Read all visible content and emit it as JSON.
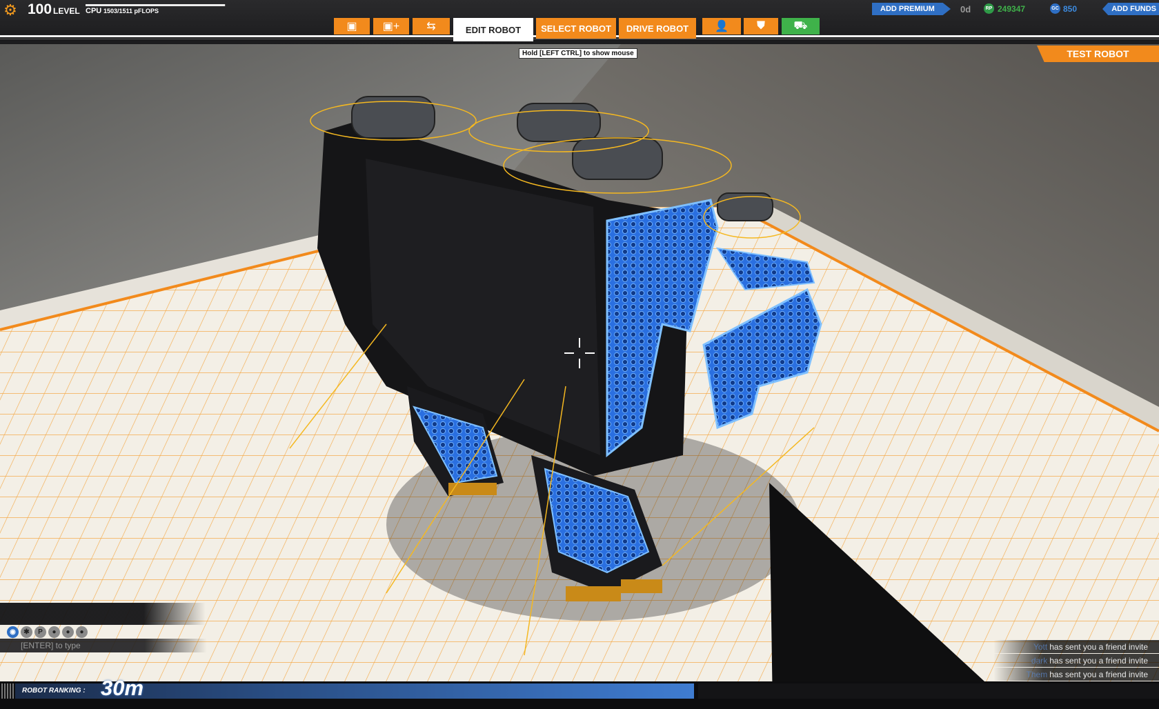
{
  "header": {
    "level_number": "100",
    "level_word": "LEVEL",
    "cpu_label": "CPU",
    "cpu_value": "1503/1511 pFLOPS",
    "cpu_fill": 0.995,
    "hint": "Hold [LEFT CTRL] to show mouse",
    "tabs": {
      "edit": "EDIT ROBOT",
      "select": "SELECT ROBOT",
      "drive": "DRIVE ROBOT"
    },
    "tool_icons": [
      "cube-icon",
      "add-cube-icon",
      "connect-icon",
      "profile-icon",
      "shield-icon",
      "garage-icon"
    ],
    "add_premium": "ADD PREMIUM",
    "premium_days": "0d",
    "rp_symbol": "RP",
    "rp_value": "249347",
    "gc_symbol": "GC",
    "gc_value": "850",
    "add_funds": "ADD FUNDS"
  },
  "actions": {
    "test_robot": "TEST ROBOT"
  },
  "chat": {
    "channel_icons": [
      "globe-icon",
      "clan-icon",
      "party-icon",
      "friend-icon",
      "friend-icon",
      "friend-icon"
    ],
    "channel_icon_glyphs": [
      "◉",
      "✱",
      "P",
      "●",
      "●",
      "●"
    ],
    "input_placeholder": "[ENTER] to type"
  },
  "notifications": [
    {
      "who": "Yott",
      "message": "has sent you a friend invite"
    },
    {
      "who": "dark",
      "message": "has sent you a friend invite"
    },
    {
      "who": "Them",
      "message": "has sent you a friend invite"
    }
  ],
  "ranking": {
    "label": "ROBOT RANKING :",
    "value": "30m"
  },
  "colors": {
    "accent": "#f28a1c",
    "premium": "#2f6fc4",
    "rp": "#3fb24a",
    "robot_glow": "#3a8cff"
  }
}
